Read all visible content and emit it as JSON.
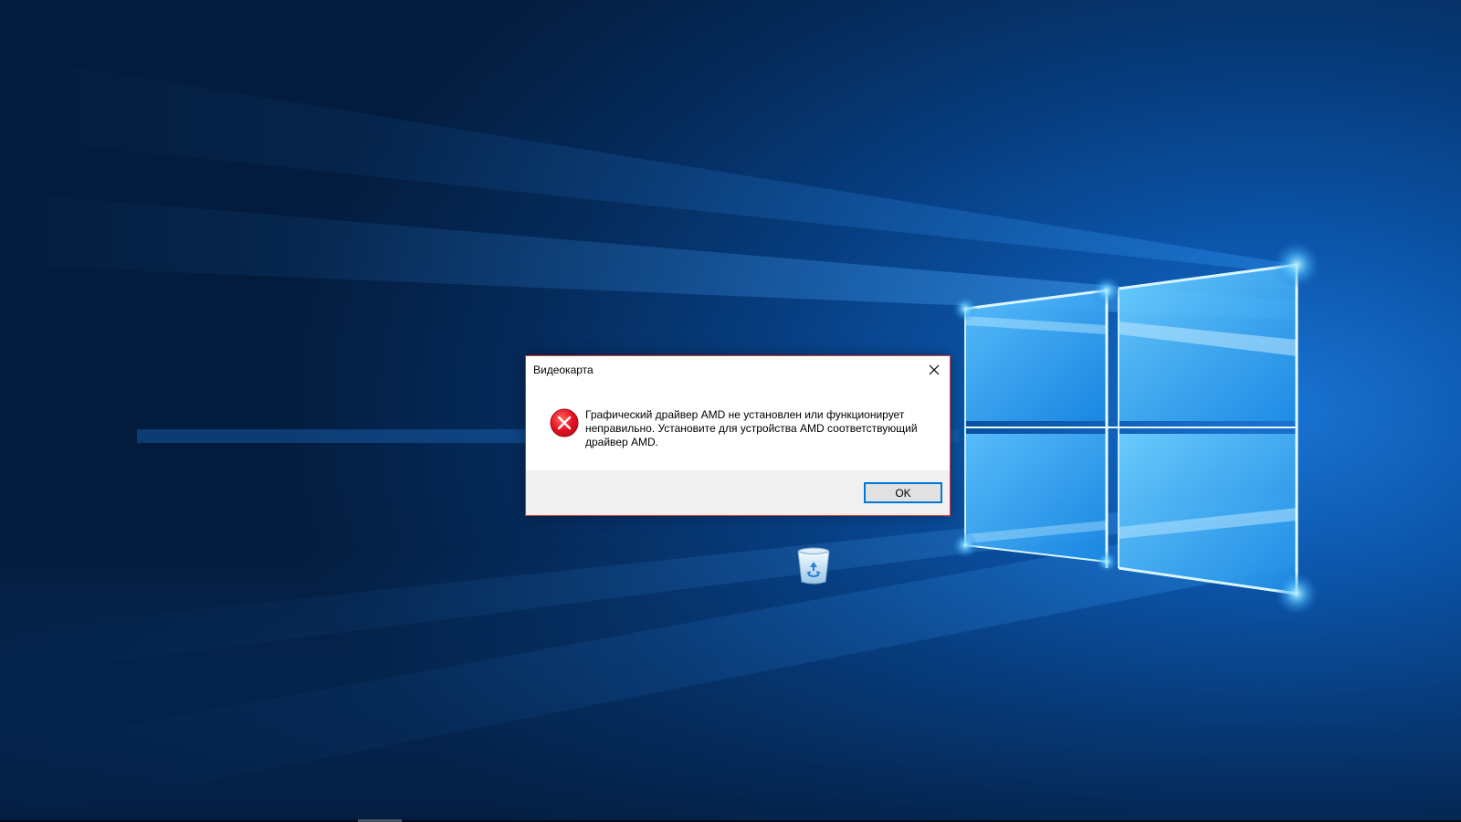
{
  "desktop": {
    "background_colors": {
      "deep": "#031c3d",
      "mid": "#0c57ad",
      "glow": "#7fd1ff"
    },
    "recycle_bin_icon": "recycle-bin-icon"
  },
  "dialog": {
    "title": "Видеокарта",
    "close_icon": "close-icon",
    "error_icon": "error-icon",
    "message_lines": [
      "Графический драйвер AMD не установлен или функционирует",
      "неправильно. Установите для устройства AMD соответствующий",
      "драйвер AMD."
    ],
    "ok_label": "OK",
    "colors": {
      "border": "#d43a3a",
      "footer": "#f0f0f0",
      "button_focus": "#0078d7",
      "error_red": "#e81123"
    }
  }
}
